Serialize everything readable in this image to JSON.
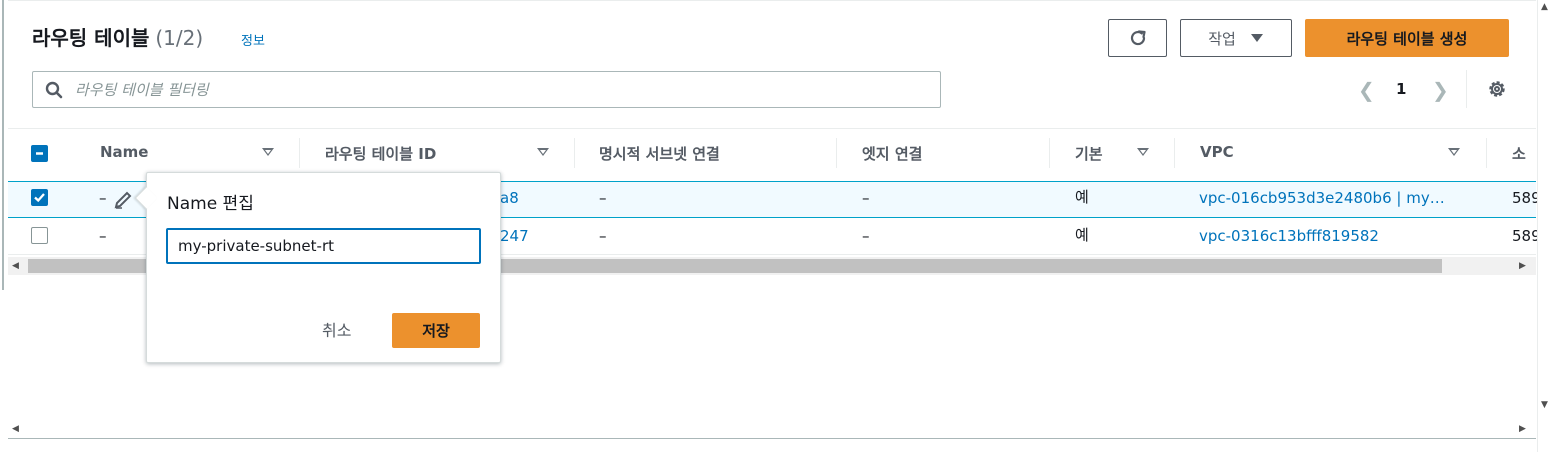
{
  "header": {
    "title": "라우팅 테이블",
    "count": "(1/2)",
    "info_link": "정보",
    "actions_label": "작업",
    "create_label": "라우팅 테이블 생성"
  },
  "search": {
    "placeholder": "라우팅 테이블 필터링"
  },
  "pagination": {
    "current_page": "1"
  },
  "table": {
    "columns": [
      "Name",
      "라우팅 테이블 ID",
      "명시적 서브넷 연결",
      "엣지 연결",
      "기본",
      "VPC",
      "소"
    ],
    "rows": [
      {
        "selected": true,
        "name": "–",
        "id_suffix": "a8",
        "subnet": "–",
        "edge": "–",
        "main": "예",
        "vpc": "vpc-016cb953d3e2480b6 | my…",
        "owner": "589"
      },
      {
        "selected": false,
        "name": "–",
        "id_suffix": "247",
        "subnet": "–",
        "edge": "–",
        "main": "예",
        "vpc": "vpc-0316c13bfff819582",
        "owner": "589"
      }
    ]
  },
  "popover": {
    "title": "Name 편집",
    "input_value": "my-private-subnet-rt",
    "cancel_label": "취소",
    "save_label": "저장"
  },
  "colors": {
    "primary": "#ec912d",
    "link": "#0073bb",
    "selected_row_bg": "#f1faff",
    "selected_row_border": "#00a1c9"
  },
  "icons": {
    "refresh": "refresh-icon",
    "actions_caret": "caret-down-icon",
    "search": "search-icon",
    "settings": "gear-icon",
    "edit": "pencil-icon"
  }
}
